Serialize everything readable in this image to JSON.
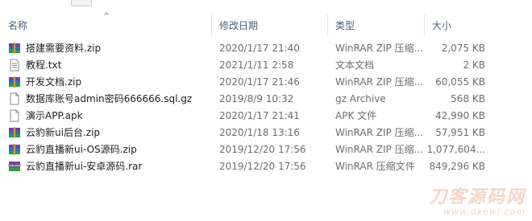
{
  "columns": {
    "name": "名称",
    "date": "修改日期",
    "type": "类型",
    "size": "大小"
  },
  "sort_indicator": "^",
  "files": [
    {
      "name": "搭建需要资料.zip",
      "date": "2020/1/17 21:40",
      "type": "WinRAR ZIP 压缩...",
      "size": "2,075 KB",
      "icon": "winrar-zip-icon"
    },
    {
      "name": "教程.txt",
      "date": "2021/1/11 2:58",
      "type": "文本文档",
      "size": "2 KB",
      "icon": "text-file-icon"
    },
    {
      "name": "开发文档.zip",
      "date": "2020/1/17 21:46",
      "type": "WinRAR ZIP 压缩...",
      "size": "60,055 KB",
      "icon": "winrar-zip-icon"
    },
    {
      "name": "数据库账号admin密码666666.sql.gz",
      "date": "2019/8/9 10:32",
      "type": "gz Archive",
      "size": "568 KB",
      "icon": "blank-file-icon"
    },
    {
      "name": "演示APP.apk",
      "date": "2020/1/17 21:41",
      "type": "APK 文件",
      "size": "42,990 KB",
      "icon": "blank-file-icon"
    },
    {
      "name": "云豹新ui后台.zip",
      "date": "2020/1/18 13:16",
      "type": "WinRAR ZIP 压缩...",
      "size": "57,951 KB",
      "icon": "winrar-zip-icon"
    },
    {
      "name": "云豹直播新ui-OS源码.zip",
      "date": "2019/12/20 17:56",
      "type": "WinRAR ZIP 压缩...",
      "size": "1,077,604...",
      "icon": "winrar-zip-icon"
    },
    {
      "name": "云豹直播新ui-安卓源码.rar",
      "date": "2019/12/20 17:56",
      "type": "WinRAR 压缩文件",
      "size": "849,296 KB",
      "icon": "winrar-rar-icon"
    }
  ],
  "watermark": {
    "title": "刀客源码网",
    "url": "www.dkewl.com"
  }
}
